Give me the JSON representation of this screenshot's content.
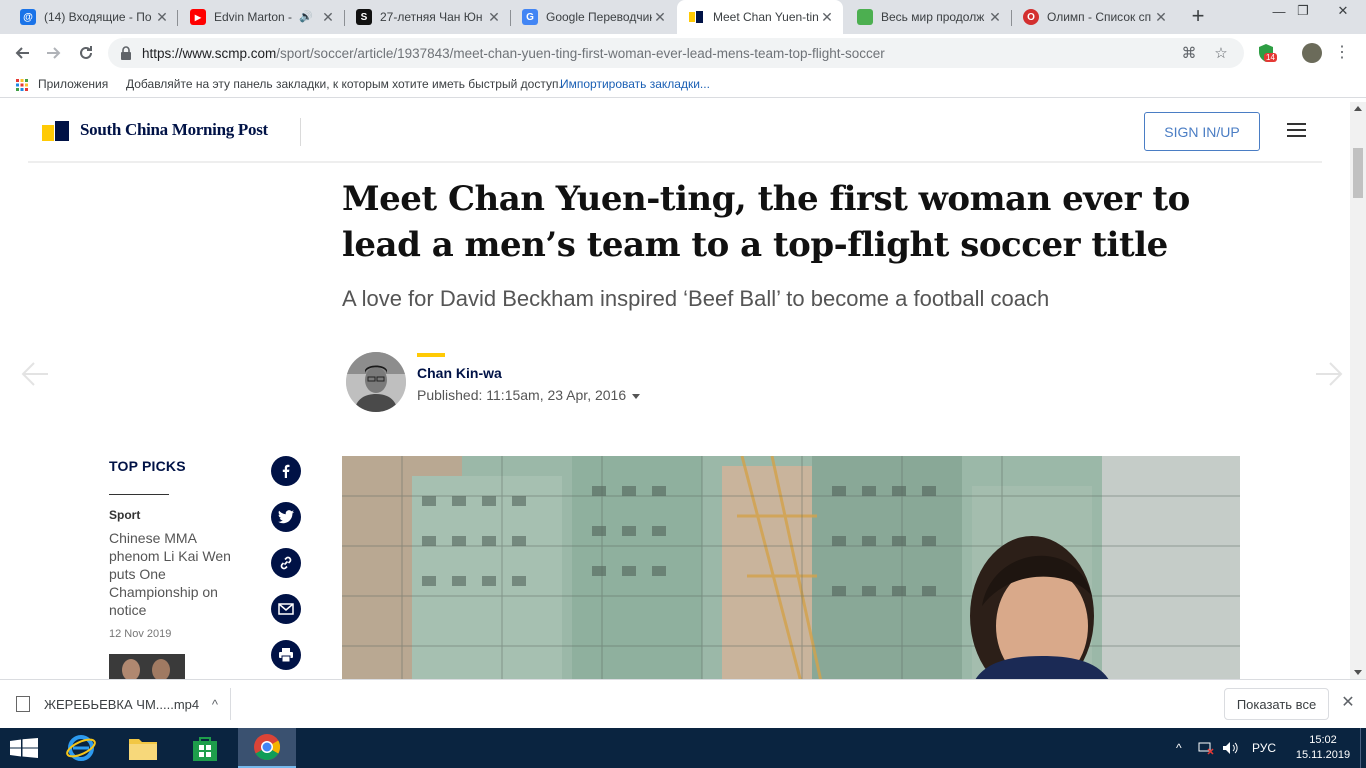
{
  "browser": {
    "tabs": [
      {
        "title": "(14) Входящие - По",
        "favicon_color": "#1a73e8",
        "favicon_glyph": "@"
      },
      {
        "title": "Edvin Marton - ",
        "favicon_color": "#ff0000",
        "favicon_glyph": "▶"
      },
      {
        "title": "27-летняя Чан Юн",
        "favicon_color": "#111111",
        "favicon_glyph": "S"
      },
      {
        "title": "Google Переводчик",
        "favicon_color": "#4285f4",
        "favicon_glyph": "G"
      },
      {
        "title": "Meet Chan Yuen-ting",
        "favicon_color": "#ffca05",
        "favicon_glyph": ""
      },
      {
        "title": "Весь мир продолж",
        "favicon_color": "#4caf50",
        "favicon_glyph": ""
      },
      {
        "title": "Олимп - Список сп",
        "favicon_color": "#d32f2f",
        "favicon_glyph": "O"
      }
    ],
    "new_tab_label": "+",
    "window_controls": {
      "minimize": "—",
      "restore": "❐",
      "close": "✕"
    },
    "url": {
      "prefix": "https://www.scmp.com",
      "path": "/sport/soccer/article/1937843/meet-chan-yuen-ting-first-woman-ever-lead-mens-team-top-flight-soccer"
    },
    "extension_badge": "14",
    "bookmarks": {
      "apps_label": "Приложения",
      "hint": "Добавляйте на эту панель закладки, к которым хотите иметь быстрый доступ.",
      "import_link": "Импортировать закладки..."
    }
  },
  "site": {
    "logo": "South China Morning Post",
    "signin": "SIGN IN/UP"
  },
  "article": {
    "headline": "Meet Chan Yuen-ting, the first woman ever to lead a men’s team to a top-flight soccer title",
    "subhead": "A love for David Beckham inspired ‘Beef Ball’ to become a football coach",
    "author": "Chan Kin-wa",
    "published": "Published: 11:15am, 23 Apr, 2016"
  },
  "top_picks": {
    "title": "TOP PICKS",
    "items": [
      {
        "section": "Sport",
        "headline": "Chinese MMA phenom Li Kai Wen puts One Championship on notice",
        "date": "12 Nov 2019"
      }
    ]
  },
  "share": [
    "facebook-icon",
    "twitter-icon",
    "link-icon",
    "email-icon",
    "print-icon"
  ],
  "downloads": {
    "file": "ЖЕРЕБЬЕВКА ЧМ.....mp4",
    "show_all": "Показать все"
  },
  "taskbar": {
    "language": "РУС",
    "time": "15:02",
    "date": "15.11.2019"
  },
  "colors": {
    "brand_navy": "#001246",
    "brand_yellow": "#ffca05",
    "signin_blue": "#4a7dc4",
    "taskbar": "#0a2440"
  }
}
